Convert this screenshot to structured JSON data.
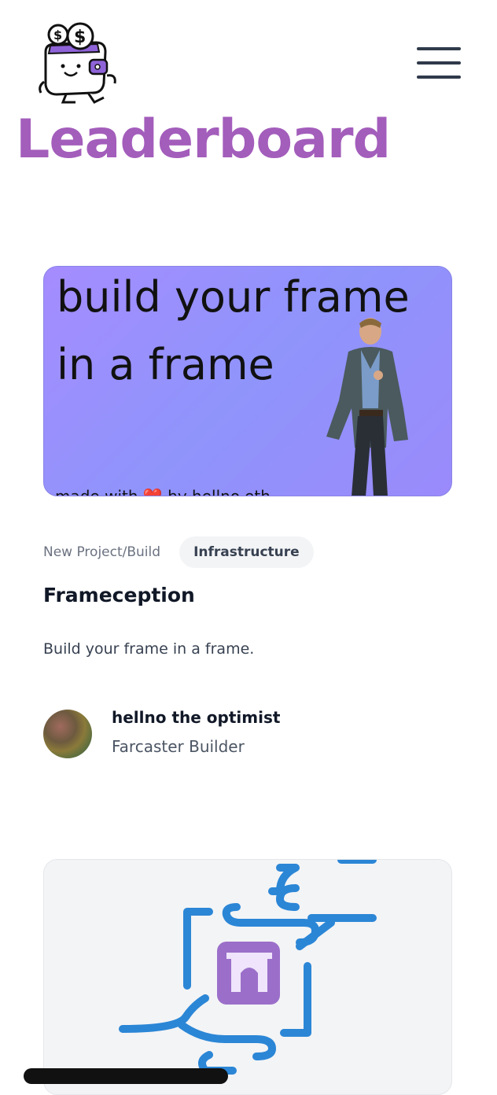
{
  "page": {
    "title": "Leaderboard"
  },
  "header": {
    "logo_icon": "wallet-mascot-icon",
    "menu_icon": "hamburger-icon"
  },
  "projects": [
    {
      "image": {
        "headline": "build your frame in a frame",
        "footer_prefix": "made with",
        "footer_heart": "❤️",
        "footer_suffix": "by hellno.eth"
      },
      "category": "New Project/Build",
      "tag": "Infrastructure",
      "title": "Frameception",
      "description": "Build your frame in a frame.",
      "author": {
        "name": "hellno the optimist",
        "role": "Farcaster Builder"
      }
    },
    {
      "image": {
        "icon": "arch-frame-icon"
      }
    }
  ],
  "colors": {
    "title": "#a35dbb",
    "pipe": "#2b86d6",
    "arch": "#9b6fc9"
  }
}
